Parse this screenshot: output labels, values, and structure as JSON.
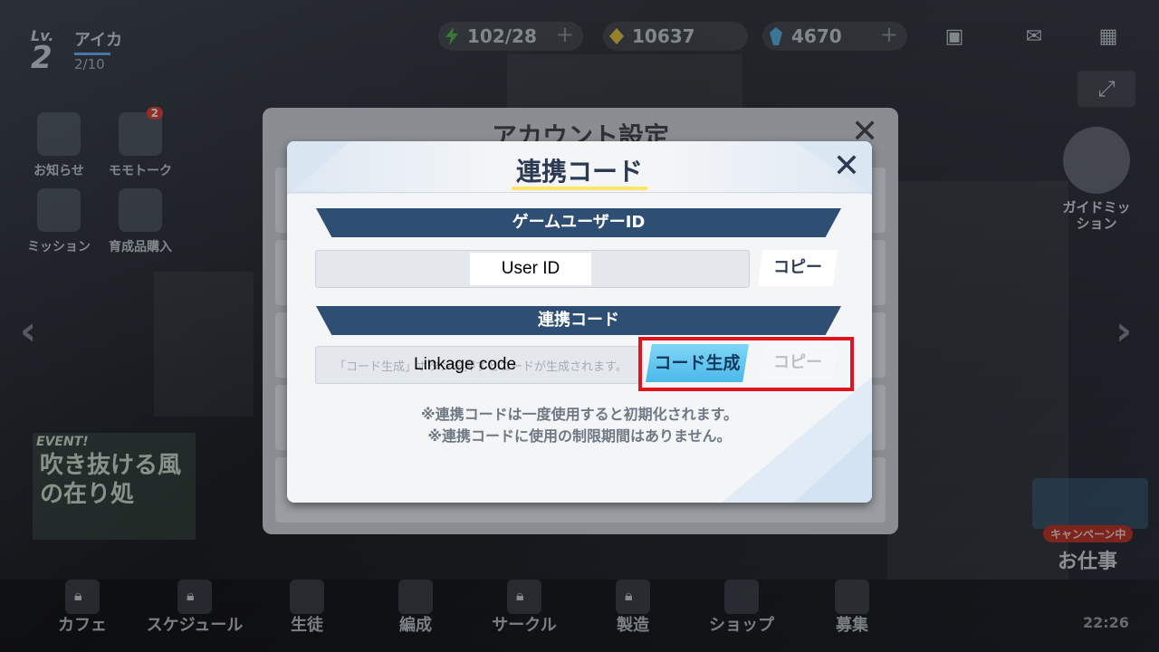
{
  "player": {
    "lv_label": "Lv.",
    "level": "2",
    "name": "アイカ",
    "exp": "2/10"
  },
  "resources": [
    {
      "name": "ap",
      "icon": "lightning-icon",
      "value": "102/28",
      "plus": "+"
    },
    {
      "name": "credits",
      "icon": "credit-coin-icon",
      "value": "10637",
      "plus": ""
    },
    {
      "name": "pyroxene",
      "icon": "gem-icon",
      "value": "4670",
      "plus": "+"
    }
  ],
  "sidebar": {
    "items": [
      {
        "label": "お知らせ",
        "icon": "notice-icon",
        "badge": ""
      },
      {
        "label": "モモトーク",
        "icon": "chat-icon",
        "badge": "2"
      },
      {
        "label": "ミッション",
        "icon": "mission-icon",
        "badge": ""
      },
      {
        "label": "育成品購入",
        "icon": "shop-bag-icon",
        "badge": ""
      }
    ]
  },
  "event_banner": {
    "tag": "EVENT!",
    "title": "吹き抜ける風の在り処"
  },
  "guide": {
    "label": "ガイドミッション"
  },
  "job": {
    "tag": "キャンペーン中",
    "label": "お仕事"
  },
  "bottom_nav": [
    {
      "label": "カフェ",
      "locked": true
    },
    {
      "label": "スケジュール",
      "locked": true
    },
    {
      "label": "生徒",
      "locked": false
    },
    {
      "label": "編成",
      "locked": false
    },
    {
      "label": "サークル",
      "locked": true
    },
    {
      "label": "製造",
      "locked": true
    },
    {
      "label": "ショップ",
      "locked": false
    },
    {
      "label": "募集",
      "locked": false
    }
  ],
  "clock": "22:26",
  "account_settings": {
    "title": "アカウント設定",
    "close": "✕"
  },
  "dialog": {
    "title": "連携コード",
    "close": "✕",
    "game_user_id_label": "ゲームユーザーID",
    "user_id_value": "User ID",
    "copy_label": "コピー",
    "linkage_code_label": "連携コード",
    "code_placeholder": "「コード生成」ボタンを押すとコードが生成されます。",
    "code_value": "Linkage code",
    "generate_label": "コード生成",
    "copy_disabled_label": "コピー",
    "note1": "※連携コードは一度使用すると初期化されます。",
    "note2": "※連携コードに使用の制限期間はありません。"
  },
  "colors": {
    "band": "#2f4e74",
    "generate_button": "#4cb8ea",
    "highlight": "#e0141e",
    "title_underline": "#ffe56a"
  }
}
